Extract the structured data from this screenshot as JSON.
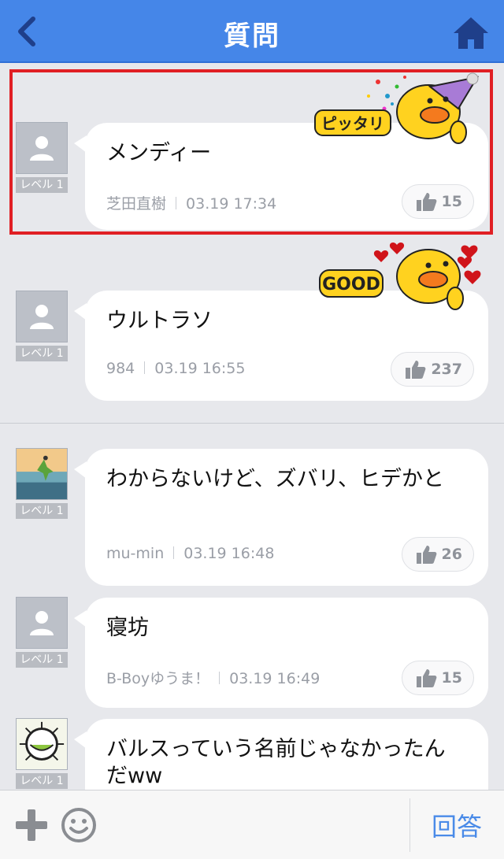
{
  "header": {
    "title": "質問",
    "back_icon": "chevron-left-icon",
    "home_icon": "home-icon"
  },
  "answers": [
    {
      "text": "メンディー",
      "author": "芝田直樹",
      "time": "03.19 17:34",
      "likes": "15",
      "level": "レベル 1",
      "avatar": "default-avatar",
      "sticker": "ピッタリ",
      "highlighted": true
    },
    {
      "text": "ウルトラソ",
      "author": "984",
      "time": "03.19 16:55",
      "likes": "237",
      "level": "レベル 1",
      "avatar": "default-avatar",
      "sticker": "GOOD"
    },
    {
      "text": "わからないけど、ズバリ、ヒデかと",
      "author": "mu-min",
      "time": "03.19 16:48",
      "likes": "26",
      "level": "レベル 1",
      "avatar": "photo-avatar"
    },
    {
      "text": "寝坊",
      "author": "B-Boyゆうま！",
      "time": "03.19 16:49",
      "likes": "15",
      "level": "レベル 1",
      "avatar": "default-avatar"
    },
    {
      "text": "バルスっていう名前じゃなかったんだww",
      "level": "レベル 1",
      "avatar": "illustration-avatar"
    }
  ],
  "bottom_bar": {
    "plus_icon": "plus-icon",
    "emoji_icon": "smiley-icon",
    "answer_label": "回答"
  },
  "colors": {
    "nav_blue": "#4586e8",
    "highlight_red": "#e01f24",
    "answer_blue": "#4a8be8"
  }
}
